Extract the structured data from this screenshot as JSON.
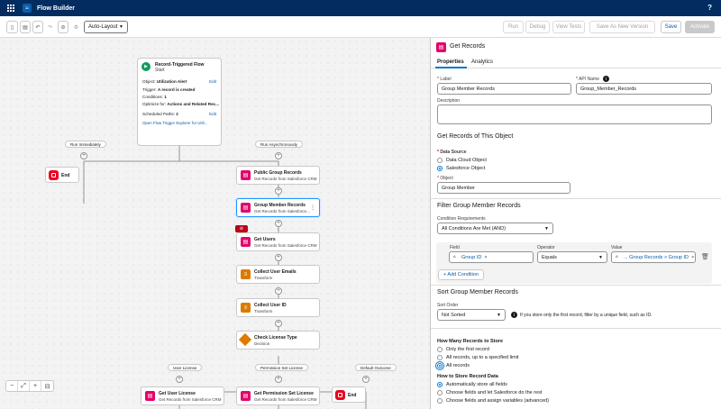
{
  "app": {
    "title": "Flow Builder",
    "help": "?"
  },
  "toolbar": {
    "layout_value": "Auto-Layout",
    "run": "Run",
    "debug": "Debug",
    "view_tests": "View Tests",
    "save_as": "Save As New Version",
    "save": "Save",
    "activate": "Activate"
  },
  "start": {
    "title": "Record-Triggered Flow",
    "subtitle": "Start",
    "object_label": "Object:",
    "object_value": "Utilization Alert",
    "trigger_label": "Trigger:",
    "trigger_value": "A record is created",
    "conditions_label": "Conditions:",
    "conditions_value": "1",
    "optimize_label": "Optimize for:",
    "optimize_value": "Actions and Related Rec...",
    "paths_label": "Scheduled Paths:",
    "paths_value": "2",
    "edit": "Edit",
    "link": "Open Flow Trigger Explorer for Utili..."
  },
  "paths": {
    "immediate": "Run Immediately",
    "async": "Run Asynchronously"
  },
  "nodes": {
    "end": "End",
    "public_group": {
      "title": "Public Group Records",
      "sub": "Get Records from Salesforce CRM"
    },
    "group_member": {
      "title": "Group Member Records",
      "sub": "Get Records from Salesforce..."
    },
    "get_users": {
      "title": "Get Users",
      "sub": "Get Records from Salesforce CRM"
    },
    "collect_emails": {
      "title": "Collect User Emails",
      "sub": "Transform"
    },
    "collect_id": {
      "title": "Collect User ID",
      "sub": "Transform"
    },
    "check_license": {
      "title": "Check License Type",
      "sub": "Decision"
    },
    "get_user_license": {
      "title": "Get User License",
      "sub": "Get Records from Salesforce CRM"
    },
    "get_perm_license": {
      "title": "Get Permission Set License",
      "sub": "Get Records from Salesforce CRM"
    }
  },
  "outcomes": {
    "user_license": "User License",
    "perm_license": "Permission Set License",
    "default": "Default Outcome"
  },
  "panel": {
    "title": "Get Records",
    "tabs": [
      "Properties",
      "Analytics"
    ],
    "label_lbl": "Label",
    "label_val": "Group Member Records",
    "api_lbl": "API Name",
    "api_val": "Group_Member_Records",
    "desc_lbl": "Description",
    "get_section": "Get Records of This Object",
    "source_lbl": "Data Source",
    "source_opt1": "Data Cloud Object",
    "source_opt2": "Salesforce Object",
    "object_lbl": "Object",
    "object_val": "Group Member",
    "filter_section": "Filter Group Member Records",
    "cond_req_lbl": "Condition Requirements",
    "cond_req_val": "All Conditions Are Met (AND)",
    "col_field": "Field",
    "col_operator": "Operator",
    "col_value": "Value",
    "field_val": "Group ID",
    "operator_val": "Equals",
    "value_val": "... Group Records > Group ID",
    "add_condition": "+ Add Condition",
    "sort_section": "Sort Group Member Records",
    "sort_lbl": "Sort Order",
    "sort_val": "Not Sorted",
    "sort_note": "If you store only the first record, filter by a unique field, such as ID.",
    "how_many_lbl": "How Many Records to Store",
    "how_many_opts": [
      "Only the first record",
      "All records, up to a specified limit",
      "All records"
    ],
    "how_store_lbl": "How to Store Record Data",
    "how_store_opts": [
      "Automatically store all fields",
      "Choose fields and let Salesforce do the rest",
      "Choose fields and assign variables (advanced)"
    ]
  },
  "colors": {
    "nav": "#032d60",
    "accent": "#0176d3",
    "pink": "#e3066a",
    "orange": "#dd7a01",
    "end": "#ea001e"
  }
}
